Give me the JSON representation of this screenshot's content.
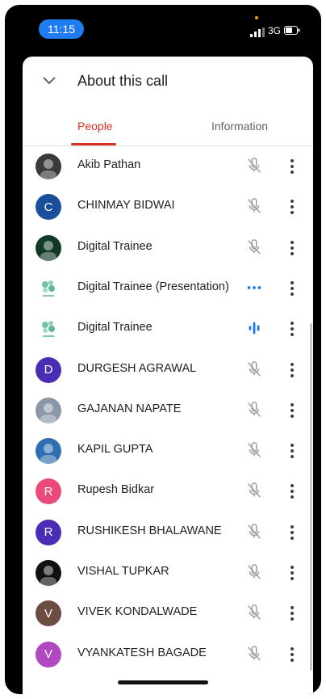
{
  "status_bar": {
    "time": "11:15",
    "network": "3G"
  },
  "header": {
    "title": "About this call",
    "collapse_icon": "chevron-down-icon"
  },
  "tabs": [
    {
      "label": "People",
      "active": true
    },
    {
      "label": "Information",
      "active": false
    }
  ],
  "participants": [
    {
      "name": "Akib Pathan",
      "avatar": "photo",
      "avatar_color": "#3a3a3a",
      "status": "muted"
    },
    {
      "name": "CHINMAY BIDWAI",
      "avatar": "C",
      "avatar_color": "#1a4f9c",
      "status": "muted"
    },
    {
      "name": "Digital Trainee",
      "avatar": "photo",
      "avatar_color": "#123a26",
      "status": "muted"
    },
    {
      "name": "Digital Trainee (Presentation)",
      "avatar": "logo",
      "avatar_color": "#ffffff",
      "status": "presenting"
    },
    {
      "name": "Digital Trainee",
      "avatar": "logo",
      "avatar_color": "#ffffff",
      "status": "speaking"
    },
    {
      "name": "DURGESH AGRAWAL",
      "avatar": "D",
      "avatar_color": "#4b2db5",
      "status": "muted"
    },
    {
      "name": "GAJANAN NAPATE",
      "avatar": "photo",
      "avatar_color": "#8a97a8",
      "status": "muted"
    },
    {
      "name": "KAPIL GUPTA",
      "avatar": "photo",
      "avatar_color": "#2d6fb2",
      "status": "muted"
    },
    {
      "name": "Rupesh Bidkar",
      "avatar": "R",
      "avatar_color": "#ea4a7a",
      "status": "muted"
    },
    {
      "name": "RUSHIKESH BHALAWANE",
      "avatar": "R",
      "avatar_color": "#4b2db5",
      "status": "muted"
    },
    {
      "name": "VISHAL TUPKAR",
      "avatar": "photo",
      "avatar_color": "#111111",
      "status": "muted"
    },
    {
      "name": "VIVEK KONDALWADE",
      "avatar": "V",
      "avatar_color": "#6d4c41",
      "status": "muted"
    },
    {
      "name": "VYANKATESH BAGADE",
      "avatar": "V",
      "avatar_color": "#b048c2",
      "status": "muted"
    }
  ],
  "colors": {
    "accent": "#d93025",
    "mic_active": "#1a73e8",
    "muted_icon": "#9e9e9e"
  }
}
